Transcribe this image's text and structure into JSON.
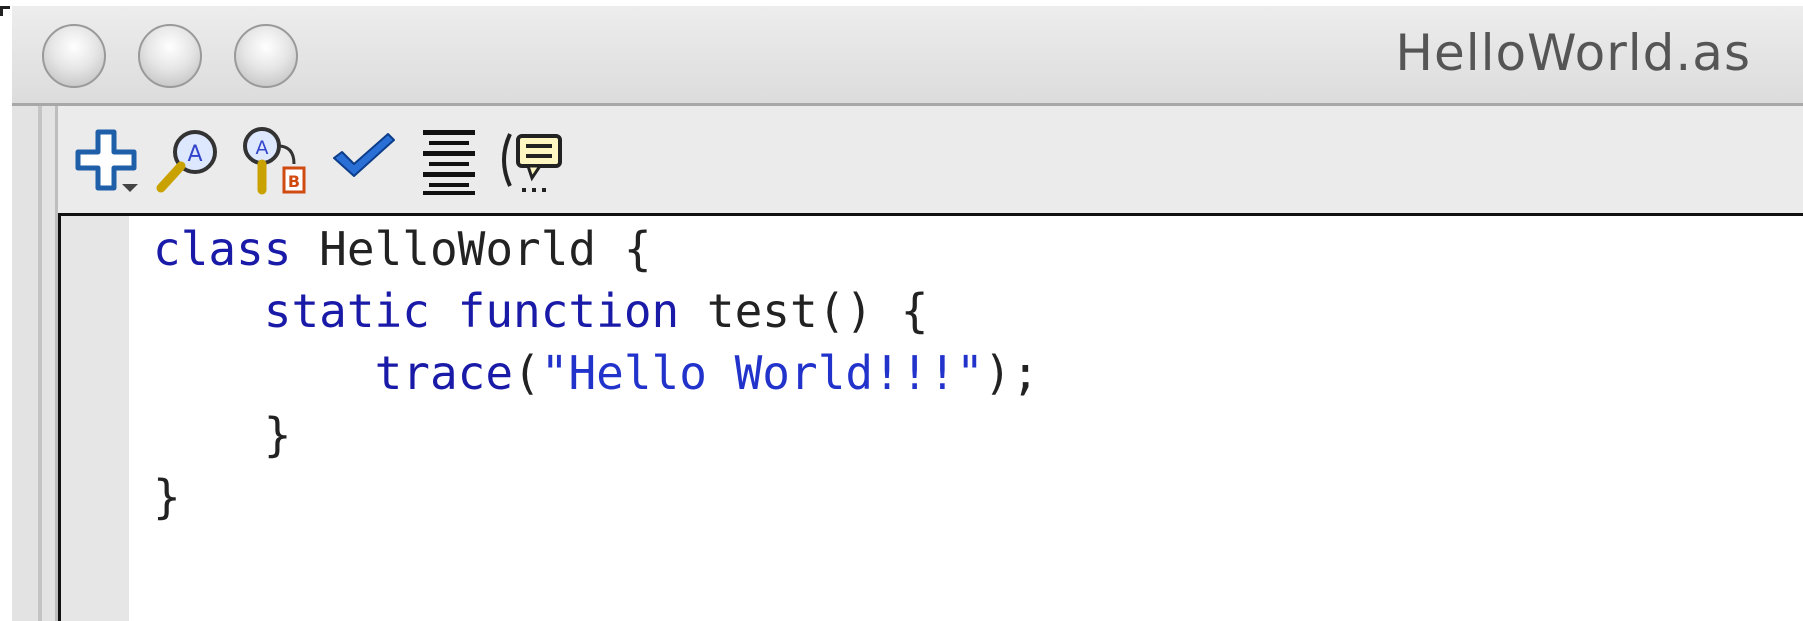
{
  "window": {
    "title": "HelloWorld.as"
  },
  "toolbar": {
    "items": [
      {
        "icon": "add-plus-icon"
      },
      {
        "icon": "find-magnifier-icon"
      },
      {
        "icon": "find-replace-icon"
      },
      {
        "icon": "check-syntax-icon"
      },
      {
        "icon": "auto-format-icon"
      },
      {
        "icon": "code-hint-icon"
      }
    ]
  },
  "editor": {
    "language": "ActionScript",
    "lines": [
      {
        "indent": "",
        "tokens": [
          {
            "t": "class",
            "k": "kw"
          },
          {
            "t": " HelloWorld {",
            "k": "plain"
          }
        ]
      },
      {
        "indent": "    ",
        "tokens": [
          {
            "t": "static",
            "k": "kw"
          },
          {
            "t": " ",
            "k": "plain"
          },
          {
            "t": "function",
            "k": "kw"
          },
          {
            "t": " test() {",
            "k": "plain"
          }
        ]
      },
      {
        "indent": "        ",
        "tokens": [
          {
            "t": "trace",
            "k": "kw"
          },
          {
            "t": "(",
            "k": "plain"
          },
          {
            "t": "\"Hello World!!!\"",
            "k": "str"
          },
          {
            "t": ");",
            "k": "plain"
          }
        ]
      },
      {
        "indent": "    ",
        "tokens": [
          {
            "t": "}",
            "k": "plain"
          }
        ]
      },
      {
        "indent": "",
        "tokens": [
          {
            "t": "}",
            "k": "plain"
          }
        ]
      }
    ]
  },
  "colors": {
    "keyword": "#1a1aa8",
    "string": "#2233cc",
    "text": "#222222",
    "toolbar_bg": "#ebebeb",
    "gutter_bg": "#e6e6e6"
  }
}
